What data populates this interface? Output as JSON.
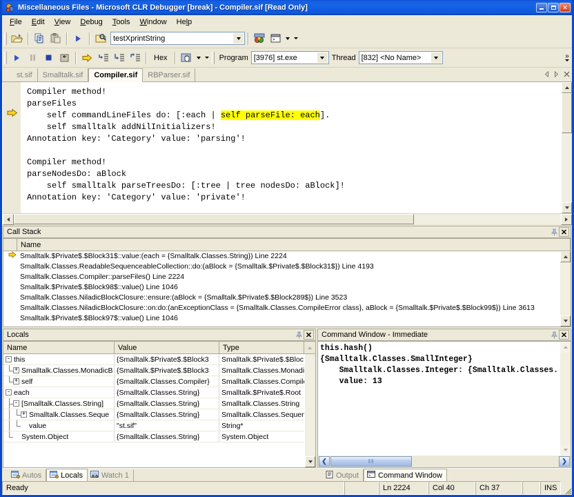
{
  "window": {
    "title": "Miscellaneous Files - Microsoft CLR Debugger [break] - Compiler.sif [Read Only]",
    "app_icon": "debugger-app-icon",
    "minimize_label": "_",
    "maximize_label": "□",
    "close_label": "✕"
  },
  "menubar": {
    "items": [
      {
        "label": "File",
        "accel": "F"
      },
      {
        "label": "Edit",
        "accel": "E"
      },
      {
        "label": "View",
        "accel": "V"
      },
      {
        "label": "Debug",
        "accel": "D"
      },
      {
        "label": "Tools",
        "accel": "T"
      },
      {
        "label": "Window",
        "accel": "W"
      },
      {
        "label": "Help",
        "accel": "H"
      }
    ]
  },
  "toolbar_top": {
    "open_icon": "open-folder-icon",
    "copy_icon": "copy-icon",
    "paste_icon": "paste-icon",
    "start_icon": "start-play-icon",
    "find_icon": "find-in-files-icon",
    "find_combo_value": "testXprintString",
    "toolbox_icon": "toolbox-icon",
    "command_window_icon": "command-window-icon"
  },
  "toolbar_debug": {
    "continue_icon": "continue-play-icon",
    "break_all_icon": "break-all-icon",
    "stop_icon": "stop-debugging-icon",
    "restart_icon": "restart-icon",
    "show_next_statement_icon": "show-next-statement-icon",
    "step_into_icon": "step-into-icon",
    "step_over_icon": "step-over-icon",
    "step_out_icon": "step-out-icon",
    "hex_label": "Hex",
    "hand_icon": "debug-windows-icon",
    "program_label": "Program",
    "program_value": "[3976] st.exe",
    "thread_label": "Thread",
    "thread_value": "[832] <No Name>",
    "overflow_label": "»"
  },
  "editor": {
    "tabs": [
      {
        "label": "st.sif",
        "active": false
      },
      {
        "label": "Smalltalk.sif",
        "active": false
      },
      {
        "label": "Compiler.sif",
        "active": true
      },
      {
        "label": "RBParser.sif",
        "active": false
      }
    ],
    "nav_prev_icon": "tab-prev-icon",
    "nav_next_icon": "tab-next-icon",
    "close_icon": "close-document-icon",
    "current_statement_icon": "current-statement-arrow",
    "code_lines": [
      {
        "pre": "Compiler method!",
        "hl": "",
        "post": ""
      },
      {
        "pre": "parseFiles",
        "hl": "",
        "post": ""
      },
      {
        "pre": "    self commandLineFiles do: [:each | ",
        "hl": "self parseFile: each",
        "post": "]."
      },
      {
        "pre": "    self smalltalk addNilInitializers!",
        "hl": "",
        "post": ""
      },
      {
        "pre": "Annotation key: 'Category' value: 'parsing'!",
        "hl": "",
        "post": ""
      },
      {
        "pre": "",
        "hl": "",
        "post": ""
      },
      {
        "pre": "Compiler method!",
        "hl": "",
        "post": ""
      },
      {
        "pre": "parseNodesDo: aBlock",
        "hl": "",
        "post": ""
      },
      {
        "pre": "    self smalltalk parseTreesDo: [:tree | tree nodesDo: aBlock]!",
        "hl": "",
        "post": ""
      },
      {
        "pre": "Annotation key: 'Category' value: 'private'!",
        "hl": "",
        "post": ""
      }
    ]
  },
  "callstack": {
    "title": "Call Stack",
    "pin_icon": "auto-hide-pin-icon",
    "close_label": "✕",
    "column_header": "Name",
    "rows": [
      {
        "marker": true,
        "text": "Smalltalk.$Private$.$Block31$::value:(each = {Smalltalk.Classes.String}) Line 2224"
      },
      {
        "marker": false,
        "text": "Smalltalk.Classes.ReadableSequenceableCollection::do:(aBlock = {Smalltalk.$Private$.$Block31$}) Line 4193"
      },
      {
        "marker": false,
        "text": "Smalltalk.Classes.Compiler::parseFiles() Line 2224"
      },
      {
        "marker": false,
        "text": "Smalltalk.$Private$.$Block98$::value() Line 1046"
      },
      {
        "marker": false,
        "text": "Smalltalk.Classes.NiladicBlockClosure::ensure:(aBlock = {Smalltalk.$Private$.$Block289$}) Line 3523"
      },
      {
        "marker": false,
        "text": "Smalltalk.Classes.NiladicBlockClosure::on:do:(anExceptionClass = {Smalltalk.Classes.CompileError class}, aBlock = {Smalltalk.$Private$.$Block99$}) Line 3613"
      },
      {
        "marker": false,
        "text": "Smalltalk.$Private$.$Block97$::value() Line 1046"
      }
    ]
  },
  "locals": {
    "title": "Locals",
    "pin_icon": "auto-hide-pin-icon",
    "close_label": "✕",
    "columns": [
      "Name",
      "Value",
      "Type"
    ],
    "rows": [
      {
        "indent": 0,
        "expander": "-",
        "name": "this",
        "value": "{Smalltalk.$Private$.$Block3",
        "type": "Smalltalk.$Private$.$Bloc"
      },
      {
        "indent": 1,
        "expander": "+",
        "name": "Smalltalk.Classes.MonadicB",
        "value": "{Smalltalk.$Private$.$Block3",
        "type": "Smalltalk.Classes.Monadi"
      },
      {
        "indent": 1,
        "expander": "+",
        "name": "self",
        "value": "{Smalltalk.Classes.Compiler}",
        "type": "Smalltalk.Classes.Compile"
      },
      {
        "indent": 0,
        "expander": "-",
        "name": "each",
        "value": "{Smalltalk.Classes.String}",
        "type": "Smalltalk.$Private$.Root"
      },
      {
        "indent": 1,
        "expander": "-",
        "name": "[Smalltalk.Classes.String]",
        "value": "{Smalltalk.Classes.String}",
        "type": "Smalltalk.Classes.String"
      },
      {
        "indent": 2,
        "expander": "+",
        "name": "Smalltalk.Classes.Seque",
        "value": "{Smalltalk.Classes.String}",
        "type": "Smalltalk.Classes.Sequen"
      },
      {
        "indent": 2,
        "expander": "",
        "name": "value",
        "value": "\"st.sif\"",
        "type": "String*"
      },
      {
        "indent": 1,
        "expander": "",
        "name": "System.Object",
        "value": "{Smalltalk.Classes.String}",
        "type": "System.Object"
      }
    ]
  },
  "command_window": {
    "title": "Command Window - Immediate",
    "pin_icon": "auto-hide-pin-icon",
    "close_label": "✕",
    "lines": [
      "this.hash()",
      "{Smalltalk.Classes.SmallInteger}",
      "    Smalltalk.Classes.Integer: {Smalltalk.Classes.",
      "    value: 13"
    ],
    "hscroll_left_label": "❮",
    "hscroll_right_label": "❯",
    "hscroll_grip": "‖‖"
  },
  "bottom_tabs_left": [
    {
      "label": "Autos",
      "icon": "autos-window-icon",
      "active": false
    },
    {
      "label": "Locals",
      "icon": "locals-window-icon",
      "active": true
    },
    {
      "label": "Watch 1",
      "icon": "watch-window-icon",
      "active": false
    }
  ],
  "bottom_tabs_right": [
    {
      "label": "Output",
      "icon": "output-window-icon",
      "active": false
    },
    {
      "label": "Command Window",
      "icon": "command-window-icon",
      "active": true
    }
  ],
  "statusbar": {
    "message": "Ready",
    "line": "Ln 2224",
    "col": "Col 40",
    "ch": "Ch 37",
    "blank": "",
    "insert_mode": "INS"
  },
  "colors": {
    "title_blue": "#1563e8",
    "face": "#ece9d8",
    "highlight_yellow": "#ffff00",
    "window_border": "#0a49c8",
    "marker_yellow": "#e8b300"
  }
}
